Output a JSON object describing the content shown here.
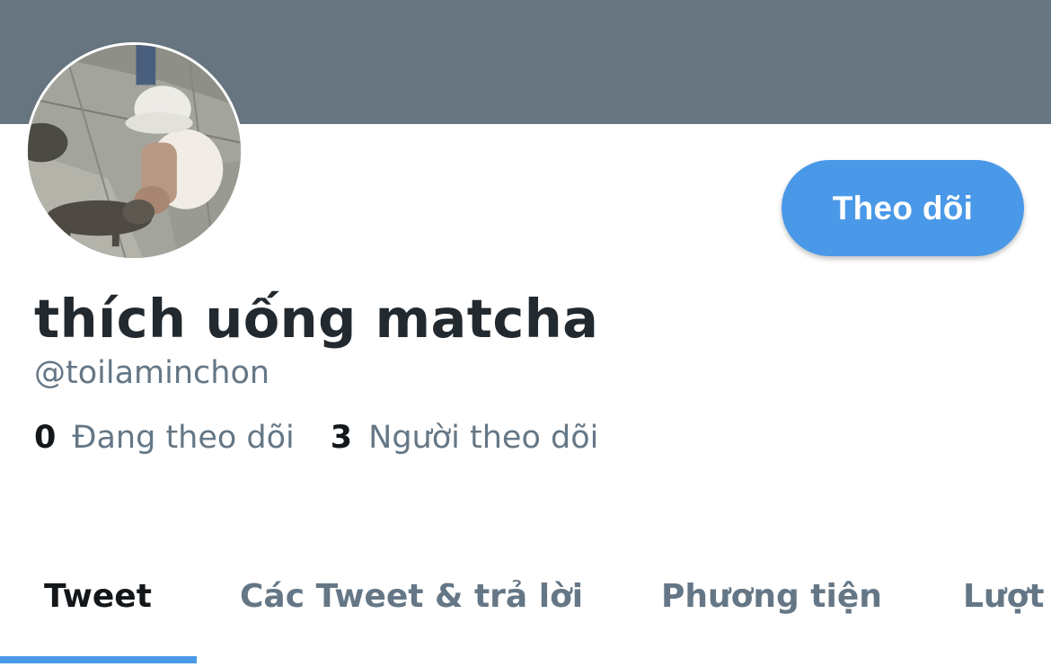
{
  "colors": {
    "banner": "#66757f",
    "accent": "#4a99e9",
    "text_primary": "#14171a",
    "text_secondary": "#657786"
  },
  "profile": {
    "avatar_icon": "profile-photo",
    "display_name": "thích uống matcha",
    "handle": "@toilaminchon",
    "follow_button_label": "Theo dõi"
  },
  "stats": {
    "following_count": "0",
    "following_label": "Đang theo dõi",
    "followers_count": "3",
    "followers_label": "Người theo dõi"
  },
  "tabs": [
    {
      "label": "Tweet",
      "active": true
    },
    {
      "label": "Các Tweet & trả lời",
      "active": false
    },
    {
      "label": "Phương tiện",
      "active": false
    },
    {
      "label": "Lượt",
      "active": false
    }
  ]
}
